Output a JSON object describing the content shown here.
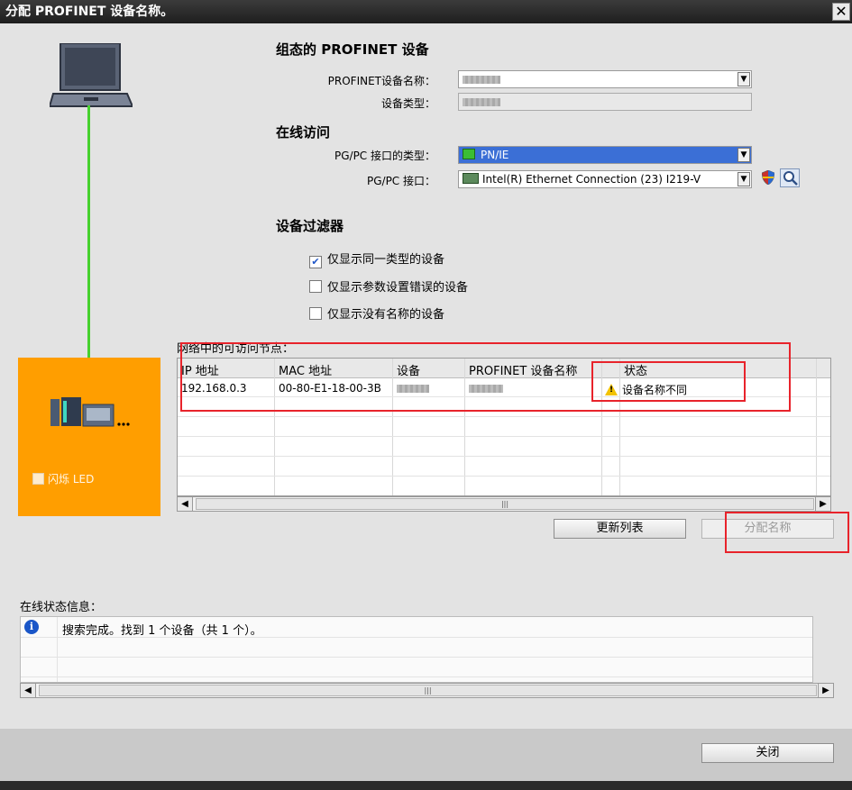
{
  "window": {
    "title": "分配 PROFINET 设备名称。",
    "close_glyph": "✕"
  },
  "configured_device": {
    "section_title": "组态的 PROFINET 设备",
    "name_label": "PROFINET设备名称：",
    "type_label": "设备类型："
  },
  "online_access": {
    "section_title": "在线访问",
    "interface_type_label": "PG/PC 接口的类型：",
    "interface_type_value": "PN/IE",
    "interface_label": "PG/PC 接口：",
    "interface_value": "Intel(R) Ethernet Connection (23) I219-V"
  },
  "device_filter": {
    "section_title": "设备过滤器",
    "options": [
      {
        "label": "仅显示同一类型的设备",
        "checked": true
      },
      {
        "label": "仅显示参数设置错误的设备",
        "checked": false
      },
      {
        "label": "仅显示没有名称的设备",
        "checked": false
      }
    ]
  },
  "node_list": {
    "caption": "网络中的可访问节点：",
    "columns": [
      "IP 地址",
      "MAC 地址",
      "设备",
      "PROFINET 设备名称",
      "状态"
    ],
    "rows": [
      {
        "ip": "192.168.0.3",
        "mac": "00-80-E1-18-00-3B",
        "status": "设备名称不同",
        "status_icon": "warning-icon"
      }
    ],
    "scroll_thumb": "|||"
  },
  "left_panel": {
    "led_label": "闪烁 LED"
  },
  "buttons": {
    "refresh": "更新列表",
    "assign": "分配名称",
    "close": "关闭"
  },
  "status": {
    "caption": "在线状态信息：",
    "message": "搜索完成。找到 1 个设备（共 1 个）。",
    "icon": "info-icon",
    "scroll_thumb": "|||"
  },
  "colors": {
    "title_bar": "#1e1e1e",
    "panel_orange": "#ff9e00",
    "link_green": "#46d12e",
    "highlight_red": "#e8232b",
    "selection_blue": "#3b6fd6"
  }
}
